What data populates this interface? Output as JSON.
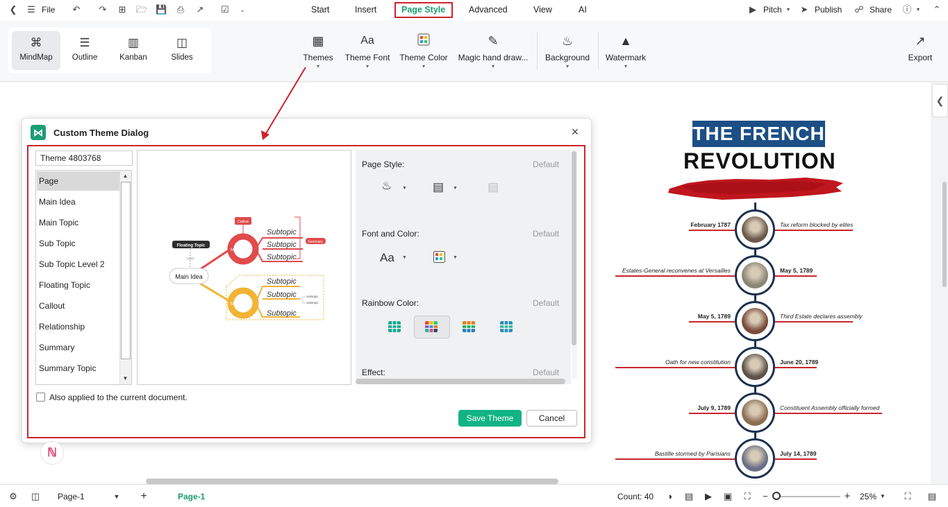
{
  "menubar": {
    "file_label": "File",
    "tabs": [
      "Start",
      "Insert",
      "Page Style",
      "Advanced",
      "View",
      "AI"
    ],
    "active_tab": "Page Style",
    "pitch_label": "Pitch",
    "publish_label": "Publish",
    "share_label": "Share"
  },
  "ribbon": {
    "views": [
      "MindMap",
      "Outline",
      "Kanban",
      "Slides"
    ],
    "active_view": "MindMap",
    "buttons": [
      "Themes",
      "Theme Font",
      "Theme Color",
      "Magic hand draw...",
      "Background",
      "Watermark"
    ],
    "export_label": "Export"
  },
  "dialog": {
    "title": "Custom Theme Dialog",
    "theme_name": "Theme 4803768",
    "elements": [
      "Page",
      "Main Idea",
      "Main Topic",
      "Sub Topic",
      "Sub Topic Level 2",
      "Floating Topic",
      "Callout",
      "Relationship",
      "Summary",
      "Summary Topic"
    ],
    "selected_element": "Page",
    "preview": {
      "main_idea": "Main Idea",
      "floating_topic": "Floating Topic",
      "label": "Label",
      "callout": "Callout",
      "summary": "Summary",
      "subtopic": "Subtopic",
      "subtopic_small": "Subtopic",
      "center_mark": "M"
    },
    "props": {
      "page_style": "Page Style:",
      "font_and_color": "Font and Color:",
      "rainbow_color": "Rainbow Color:",
      "effect": "Effect:",
      "default": "Default",
      "font_glyph": "Aa"
    },
    "also_applied": "Also applied to the current document.",
    "save_label": "Save Theme",
    "cancel_label": "Cancel"
  },
  "infographic": {
    "title_line1": "THE FRENCH",
    "title_line2": "REVOLUTION",
    "events": [
      {
        "left": "February 1787",
        "right": "Tax reform blocked by elites"
      },
      {
        "left": "Estates-General reconvenes at Versailles",
        "right": "May 5, 1789"
      },
      {
        "left": "May 5, 1789",
        "right": "Third Estate declares assembly"
      },
      {
        "left": "Oath for new constitution",
        "right": "June 20, 1789"
      },
      {
        "left": "July 9, 1789",
        "right": "Constituent Assembly officially formed"
      },
      {
        "left": "Bastille stormed by Parisians",
        "right": "July 14, 1789"
      }
    ]
  },
  "statusbar": {
    "page_select": "Page-1",
    "page_tab": "Page-1",
    "count": "Count: 40",
    "zoom": "25%"
  },
  "colors": {
    "accent": "#1a9d74",
    "highlight": "#c9252c",
    "save_button": "#12b384",
    "title_blue": "#1c4f85",
    "timeline": "#1b3050"
  }
}
